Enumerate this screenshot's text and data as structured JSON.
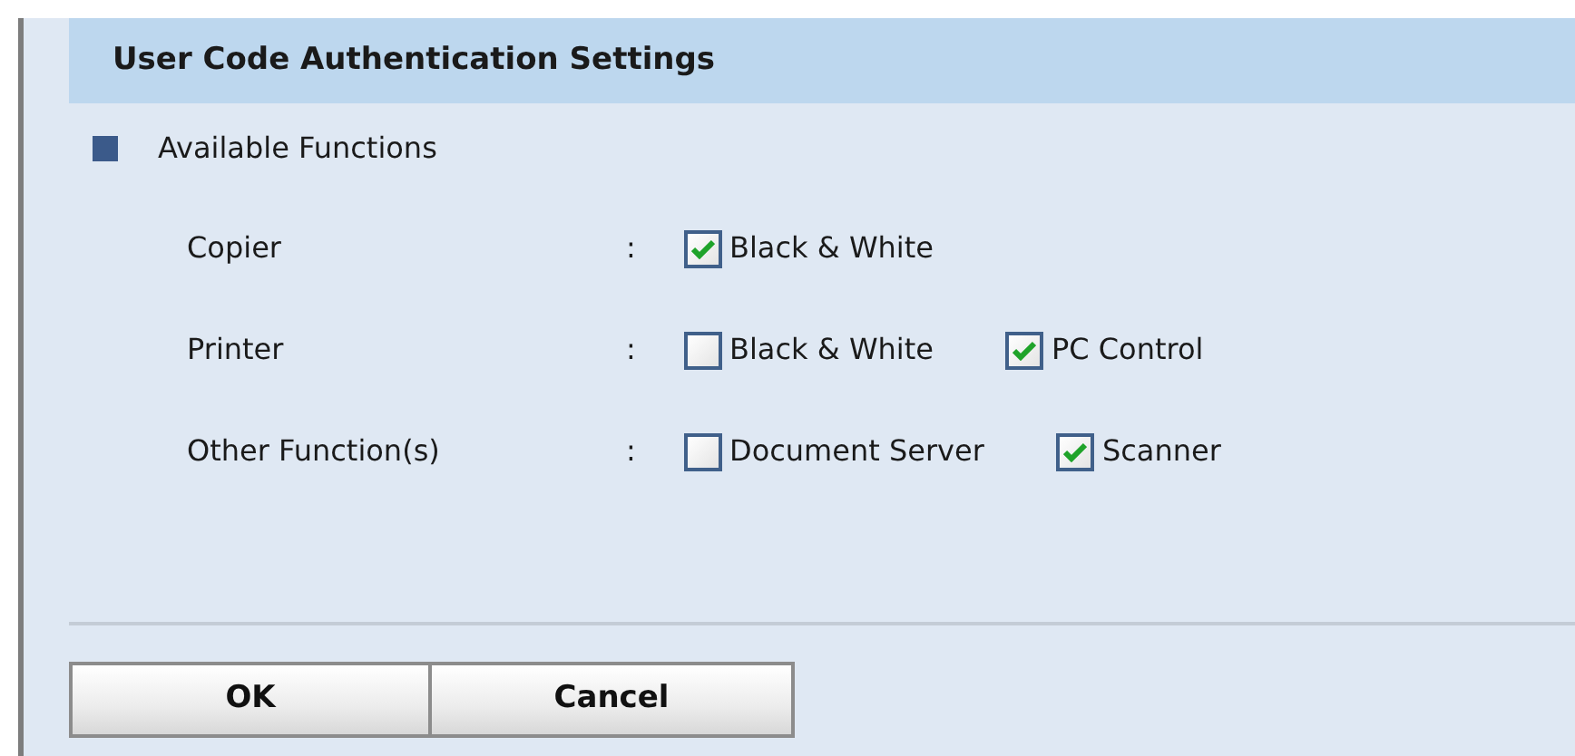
{
  "header": {
    "title": "User Code Authentication Settings"
  },
  "section": {
    "title": "Available Functions"
  },
  "rows": [
    {
      "label": "Copier",
      "separator": ":",
      "options": [
        {
          "label": "Black & White",
          "checked": true
        }
      ]
    },
    {
      "label": "Printer",
      "separator": ":",
      "options": [
        {
          "label": "Black & White",
          "checked": false
        },
        {
          "label": "PC Control",
          "checked": true
        }
      ]
    },
    {
      "label": "Other Function(s)",
      "separator": ":",
      "options": [
        {
          "label": "Document Server",
          "checked": false
        },
        {
          "label": "Scanner",
          "checked": true
        }
      ]
    }
  ],
  "buttons": [
    "OK",
    "Cancel"
  ]
}
